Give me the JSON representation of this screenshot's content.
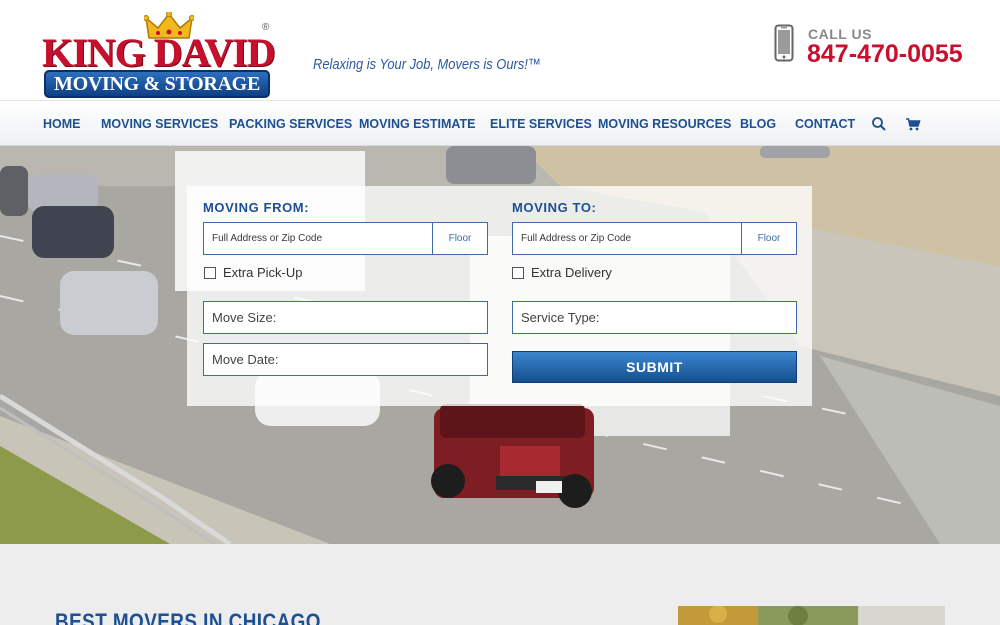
{
  "header": {
    "logo_top": "KING DAVID",
    "logo_bottom": "MOVING & STORAGE",
    "logo_reg": "®",
    "tagline": "Relaxing is Your Job, Movers is Ours!™",
    "call_label": "CALL US",
    "phone": "847-470-0055"
  },
  "nav": {
    "items": [
      "HOME",
      "MOVING SERVICES",
      "PACKING SERVICES",
      "MOVING ESTIMATE",
      "ELITE SERVICES",
      "MOVING RESOURCES",
      "BLOG",
      "CONTACT"
    ],
    "search_icon": "search-icon",
    "cart_icon": "cart-icon"
  },
  "form": {
    "from_label": "MOVING FROM:",
    "to_label": "MOVING TO:",
    "address_placeholder": "Full Address or Zip Code",
    "floor_placeholder": "Floor",
    "extra_pickup": "Extra Pick-Up",
    "extra_delivery": "Extra Delivery",
    "move_size": "Move Size:",
    "move_date": "Move Date:",
    "service_type": "Service Type:",
    "submit": "SUBMIT"
  },
  "content": {
    "heading": "BEST MOVERS IN CHICAGO"
  },
  "colors": {
    "brand_red": "#c8102e",
    "brand_blue": "#1d4f91"
  }
}
